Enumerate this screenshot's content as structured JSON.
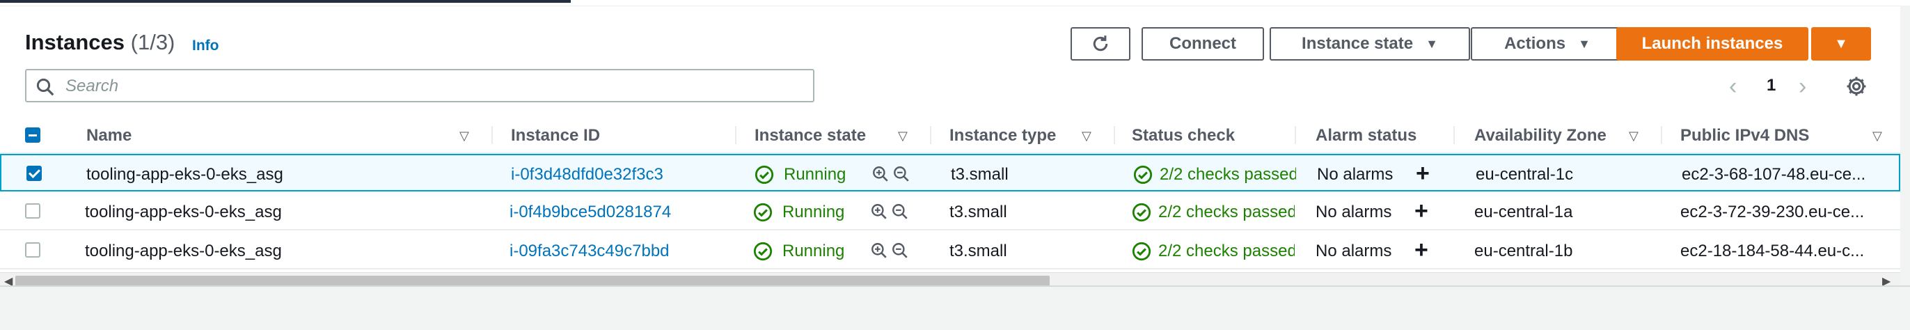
{
  "header": {
    "title": "Instances",
    "count": "(1/3)",
    "info_label": "Info"
  },
  "toolbar": {
    "connect_label": "Connect",
    "instance_state_label": "Instance state",
    "actions_label": "Actions",
    "launch_label": "Launch instances"
  },
  "search": {
    "placeholder": "Search",
    "value": ""
  },
  "pagination": {
    "current_page": "1"
  },
  "table": {
    "columns": [
      "Name",
      "Instance ID",
      "Instance state",
      "Instance type",
      "Status check",
      "Alarm status",
      "Availability Zone",
      "Public IPv4 DNS"
    ],
    "rows": [
      {
        "selected": true,
        "name": "tooling-app-eks-0-eks_asg",
        "instance_id": "i-0f3d48dfd0e32f3c3",
        "state": "Running",
        "type": "t3.small",
        "status_check": "2/2 checks passed",
        "alarm": "No alarms",
        "az": "eu-central-1c",
        "dns": "ec2-3-68-107-48.eu-ce..."
      },
      {
        "selected": false,
        "name": "tooling-app-eks-0-eks_asg",
        "instance_id": "i-0f4b9bce5d0281874",
        "state": "Running",
        "type": "t3.small",
        "status_check": "2/2 checks passed",
        "alarm": "No alarms",
        "az": "eu-central-1a",
        "dns": "ec2-3-72-39-230.eu-ce..."
      },
      {
        "selected": false,
        "name": "tooling-app-eks-0-eks_asg",
        "instance_id": "i-09fa3c743c49c7bbd",
        "state": "Running",
        "type": "t3.small",
        "status_check": "2/2 checks passed",
        "alarm": "No alarms",
        "az": "eu-central-1b",
        "dns": "ec2-18-184-58-44.eu-c..."
      }
    ]
  },
  "colors": {
    "primary": "#ec7211",
    "link": "#0073bb",
    "success": "#1d8102",
    "selected_row": "#f1faff"
  }
}
